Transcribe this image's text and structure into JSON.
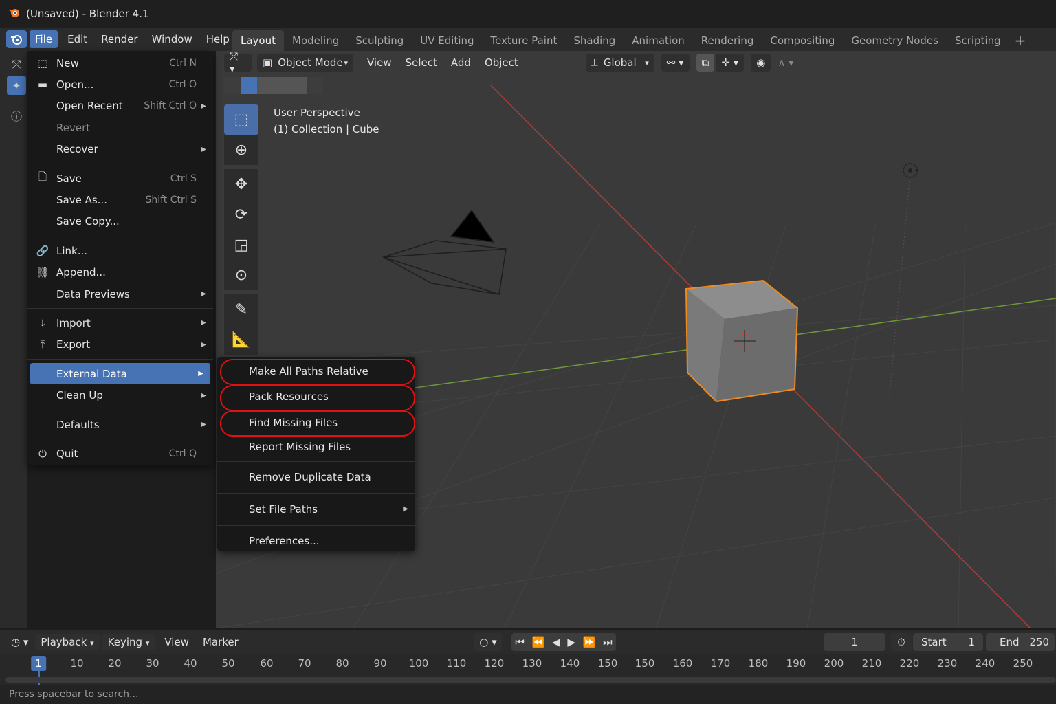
{
  "window": {
    "title": "(Unsaved) - Blender 4.1"
  },
  "menubar": {
    "items": [
      "File",
      "Edit",
      "Render",
      "Window",
      "Help"
    ]
  },
  "workspaces": {
    "tabs": [
      "Layout",
      "Modeling",
      "Sculpting",
      "UV Editing",
      "Texture Paint",
      "Shading",
      "Animation",
      "Rendering",
      "Compositing",
      "Geometry Nodes",
      "Scripting"
    ],
    "add": "+"
  },
  "viewport": {
    "mode": "Object Mode",
    "menus": [
      "View",
      "Select",
      "Add",
      "Object"
    ],
    "transform": "Global",
    "info_line1": "User Perspective",
    "info_line2": "(1) Collection | Cube"
  },
  "file_menu": {
    "new": {
      "label": "New",
      "shortcut": "Ctrl N"
    },
    "open": {
      "label": "Open...",
      "shortcut": "Ctrl O"
    },
    "open_recent": {
      "label": "Open Recent",
      "shortcut": "Shift Ctrl O"
    },
    "revert": {
      "label": "Revert"
    },
    "recover": {
      "label": "Recover"
    },
    "save": {
      "label": "Save",
      "shortcut": "Ctrl S"
    },
    "save_as": {
      "label": "Save As...",
      "shortcut": "Shift Ctrl S"
    },
    "save_copy": {
      "label": "Save Copy..."
    },
    "link": {
      "label": "Link..."
    },
    "append": {
      "label": "Append..."
    },
    "data_previews": {
      "label": "Data Previews"
    },
    "import": {
      "label": "Import"
    },
    "export": {
      "label": "Export"
    },
    "external_data": {
      "label": "External Data"
    },
    "clean_up": {
      "label": "Clean Up"
    },
    "defaults": {
      "label": "Defaults"
    },
    "quit": {
      "label": "Quit",
      "shortcut": "Ctrl Q"
    }
  },
  "external_data_menu": {
    "make_relative": "Make All Paths Relative",
    "pack_resources": "Pack Resources",
    "find_missing": "Find Missing Files",
    "report_missing": "Report Missing Files",
    "remove_duplicate": "Remove Duplicate Data",
    "set_file_paths": "Set File Paths",
    "preferences": "Preferences..."
  },
  "timeline": {
    "playback": "Playback",
    "keying": "Keying",
    "view": "View",
    "marker": "Marker",
    "current_frame": "1",
    "start_label": "Start",
    "start": "1",
    "end_label": "End",
    "end": "250",
    "ticks": [
      "1",
      "10",
      "20",
      "30",
      "40",
      "50",
      "60",
      "70",
      "80",
      "90",
      "100",
      "110",
      "120",
      "130",
      "140",
      "150",
      "150",
      "160",
      "170",
      "180",
      "190",
      "200",
      "210",
      "220",
      "230",
      "240",
      "250"
    ]
  },
  "status": {
    "text": "Press spacebar to search..."
  },
  "colors": {
    "accent": "#4772b3",
    "highlight_circle": "#e01010",
    "selection_outline": "#f08a1c"
  }
}
